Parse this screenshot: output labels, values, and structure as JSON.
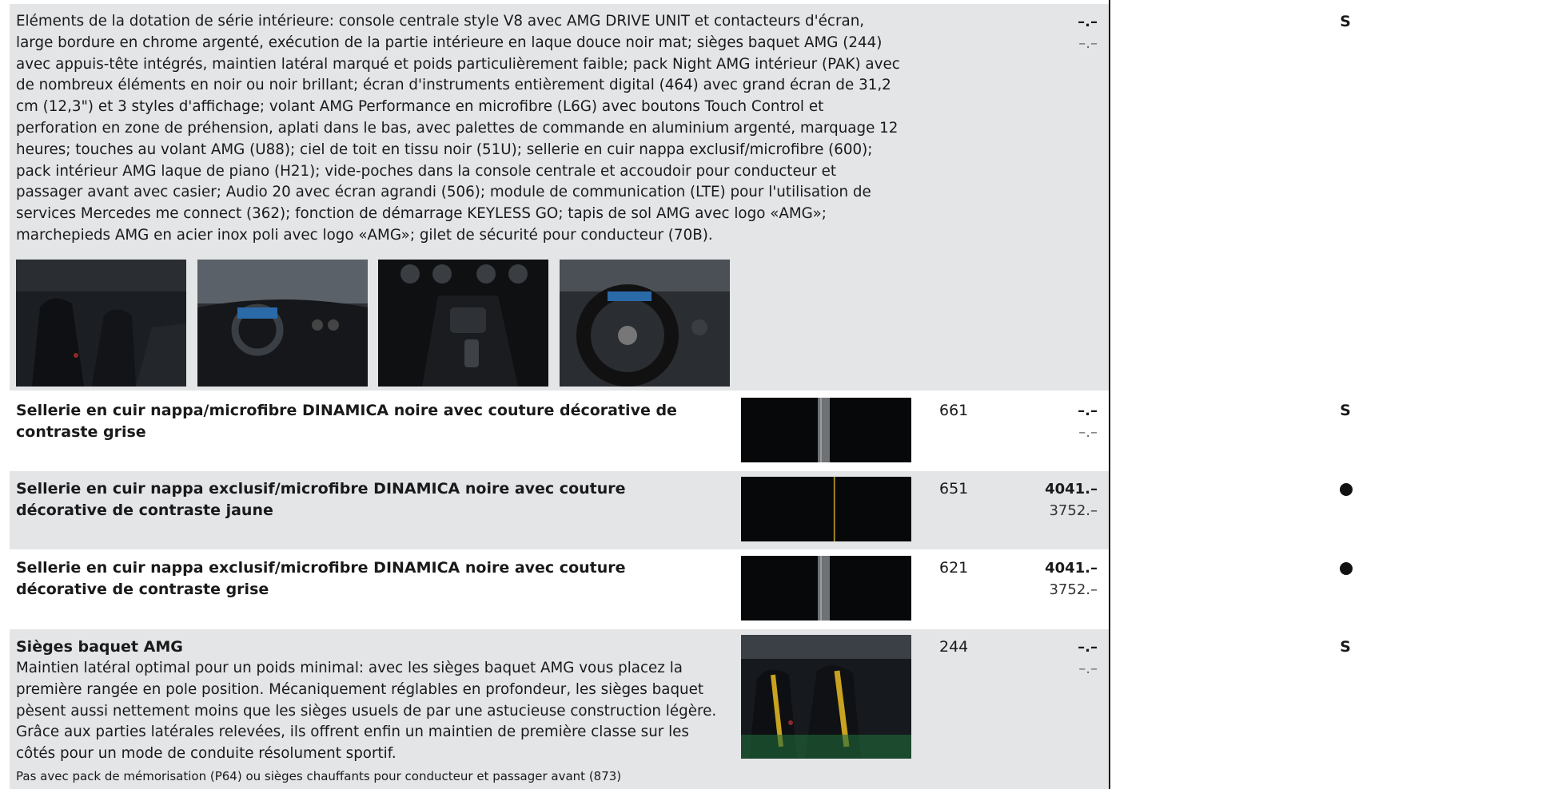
{
  "standard_interior": {
    "description": "Eléments de la dotation de série intérieure: console centrale style V8 avec AMG DRIVE UNIT et contacteurs d'écran, large bordure en chrome argenté, exécution de la partie intérieure en laque douce noir mat; sièges baquet AMG (244) avec appuis-tête intégrés, maintien latéral marqué et poids particulièrement faible; pack Night AMG intérieur (PAK) avec de nombreux éléments en noir ou noir brillant; écran d'instruments entièrement digital (464) avec grand écran de 31,2 cm (12,3\") et 3 styles d'affichage; volant AMG Performance en microfibre (L6G) avec boutons Touch Control et perforation en zone de préhension, aplati dans le bas, avec palettes de commande en aluminium argenté, marquage 12 heures; touches au volant AMG (U88); ciel de toit en tissu noir (51U); sellerie en cuir nappa exclusif/microfibre (600); pack intérieur AMG laque de piano (H21); vide-poches dans la console centrale et accoudoir pour conducteur et passager avant avec casier; Audio 20 avec écran agrandi (506); module de communication (LTE) pour l'utilisation de services Mercedes me connect (362); fonction de démarrage KEYLESS GO; tapis de sol AMG avec logo «AMG»; marchepieds AMG en acier inox poli avec logo «AMG»; gilet de sécurité pour conducteur (70B).",
    "price_incl": "–.–",
    "price_excl": "–.–",
    "availability": "S"
  },
  "rows": [
    {
      "title": "Sellerie en cuir nappa/microfibre DINAMICA noire avec couture décorative de contraste grise",
      "code": "661",
      "price_incl": "–.–",
      "price_excl": "–.–",
      "availability": "S"
    },
    {
      "title": "Sellerie en cuir nappa exclusif/microfibre DINAMICA noire avec couture décorative de contraste jaune",
      "code": "651",
      "price_incl": "4041.–",
      "price_excl": "3752.–",
      "availability_icon": "filled-dot"
    },
    {
      "title": "Sellerie en cuir nappa exclusif/microfibre DINAMICA noire avec couture décorative de contraste grise",
      "code": "621",
      "price_incl": "4041.–",
      "price_excl": "3752.–",
      "availability_icon": "filled-dot"
    },
    {
      "title": "Sièges baquet AMG",
      "description": "Maintien latéral optimal pour un poids minimal: avec les sièges baquet AMG vous placez la première rangée en pole position. Mécaniquement réglables en profondeur, les sièges baquet pèsent aussi nettement moins que les sièges usuels de par une astucieuse construction légère. Grâce aux parties latérales relevées, ils offrent enfin un maintien de première classe sur les côtés pour un mode de conduite résolument sportif.",
      "note": "Pas avec pack de mémorisation (P64) ou sièges chauffants pour conducteur et passager avant (873)",
      "code": "244",
      "price_incl": "–.–",
      "price_excl": "–.–",
      "availability": "S"
    }
  ],
  "colors": {
    "row_grey": "#e4e5e7",
    "swatch_black": "#07080a",
    "stitch_grey": "#6f7275",
    "stitch_yellow": "#b8962a"
  }
}
